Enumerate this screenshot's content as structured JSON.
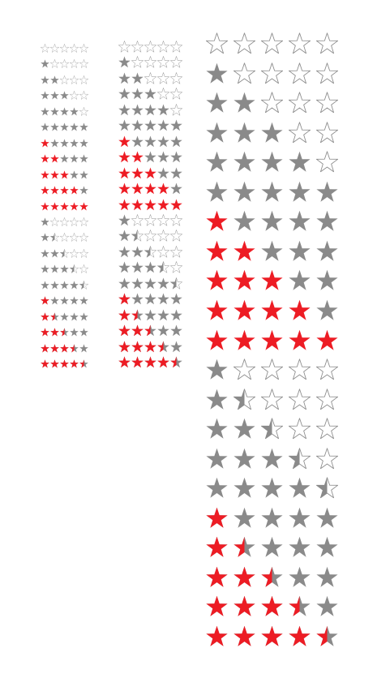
{
  "colors": {
    "empty_outline": "#8c8c8c",
    "gray_fill": "#8a8a8a",
    "red_fill": "#ed1c24"
  },
  "icon": "star-icon",
  "row_styles": [
    "empty",
    "gray",
    "gray",
    "gray",
    "gray",
    "gray",
    "red",
    "red",
    "red",
    "red",
    "red",
    "half",
    "half",
    "half",
    "half",
    "half",
    "red-half",
    "red-half",
    "red-half",
    "red-half",
    "red-half"
  ],
  "ratings": [
    0,
    1,
    2,
    3,
    4,
    5,
    1,
    2,
    3,
    4,
    5,
    1,
    1.5,
    2.5,
    3.5,
    4.5,
    1,
    1.5,
    2.5,
    3.5,
    4.5
  ],
  "star_sets": [
    {
      "name": "small"
    },
    {
      "name": "medium"
    },
    {
      "name": "large"
    }
  ]
}
